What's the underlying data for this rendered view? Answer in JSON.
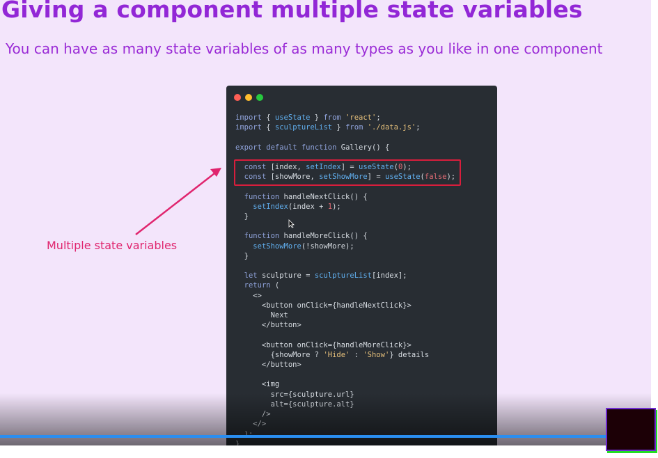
{
  "slide": {
    "title": "Giving a component multiple state variables",
    "subtitle": "You can have as many state variables of as many types as you like in one component",
    "annotation": "Multiple state variables"
  },
  "code_window": {
    "dot_colors": [
      "#ff5f56",
      "#ffbd2e",
      "#27c93f"
    ],
    "lines": [
      "import { useState } from 'react';",
      "import { sculptureList } from './data.js';",
      "",
      "export default function Gallery() {",
      "",
      "  const [index, setIndex] = useState(0);",
      "  const [showMore, setShowMore] = useState(false);",
      "",
      "  function handleNextClick() {",
      "    setIndex(index + 1);",
      "  }",
      "",
      "  function handleMoreClick() {",
      "    setShowMore(!showMore);",
      "  }",
      "",
      "  let sculpture = sculptureList[index];",
      "  return (",
      "    <>",
      "      <button onClick={handleNextClick}>",
      "        Next",
      "      </button>",
      "",
      "      <button onClick={handleMoreClick}>",
      "        {showMore ? 'Hide' : 'Show'} details",
      "      </button>",
      "",
      "      <img",
      "        src={sculpture.url}",
      "        alt={sculpture.alt}",
      "      />",
      "    </>",
      "  );",
      "}"
    ]
  },
  "colors": {
    "title": "#9227d6",
    "annotation": "#e0256e",
    "highlight_box": "#d81e3c",
    "slide_background": "#f3e5fb",
    "code_background": "#282d33"
  },
  "video_player": {
    "progress": 0.933,
    "progress_color": "#2a8ef0"
  }
}
